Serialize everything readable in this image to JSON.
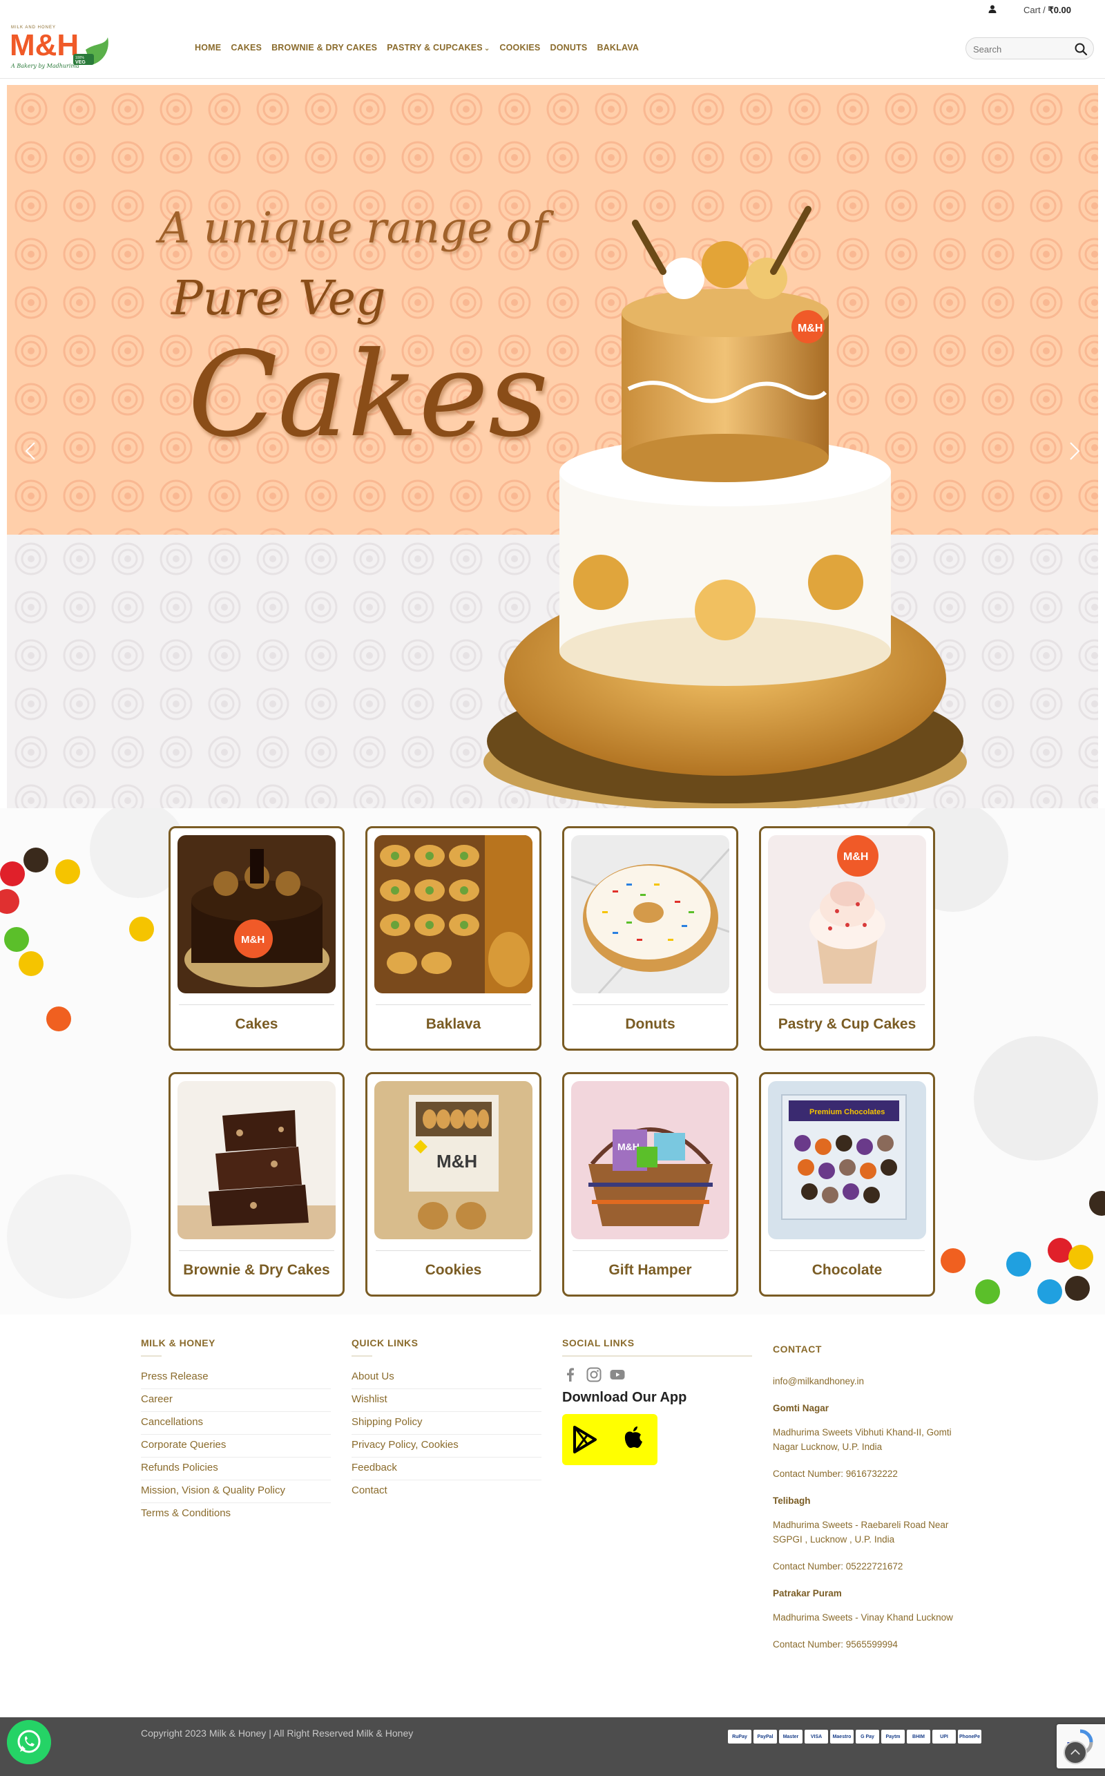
{
  "topbar": {
    "cart_label": "Cart /",
    "cart_amount": "₹0.00"
  },
  "header": {
    "logo_small_text": "MILK AND HONEY",
    "logo_text": "M&H",
    "logo_tagline": "A Bakery by Madhurima",
    "logo_badge": "100% VEG",
    "nav": [
      {
        "label": "HOME"
      },
      {
        "label": "CAKES"
      },
      {
        "label": "BROWNIE & DRY CAKES"
      },
      {
        "label": "PASTRY & CUPCAKES"
      },
      {
        "label": "COOKIES"
      },
      {
        "label": "DONUTS"
      },
      {
        "label": "BAKLAVA"
      }
    ],
    "search_placeholder": "Search"
  },
  "hero": {
    "line1": "A unique range of",
    "line2": "Pure Veg",
    "line3": "Cakes",
    "cake_badge": "M&H",
    "colors": {
      "peach": "#ffcfaa",
      "grey": "#f3f1f2",
      "script": "#8a4d18"
    }
  },
  "categories": [
    {
      "label": "Cakes",
      "icon": "chocolate-cake-image"
    },
    {
      "label": "Baklava",
      "icon": "baklava-image"
    },
    {
      "label": "Donuts",
      "icon": "donut-image"
    },
    {
      "label": "Pastry & Cup Cakes",
      "icon": "cupcake-image",
      "badge": "M&H"
    },
    {
      "label": "Brownie & Dry Cakes",
      "icon": "brownie-image"
    },
    {
      "label": "Cookies",
      "icon": "cookies-box-image",
      "badge": "M&H"
    },
    {
      "label": "Gift Hamper",
      "icon": "gift-hamper-image",
      "badge": "M&H"
    },
    {
      "label": "Chocolate",
      "icon": "chocolate-box-image",
      "badge": "Premium Chocolates"
    }
  ],
  "footer": {
    "col1": {
      "title": "MILK & HONEY",
      "links": [
        "Press Release",
        "Career",
        "Cancellations",
        "Corporate Queries",
        "Refunds Policies",
        "Mission, Vision & Quality Policy",
        "Terms & Conditions"
      ]
    },
    "col2": {
      "title": "QUICK LINKS",
      "links": [
        "About Us",
        "Wishlist",
        "Shipping Policy",
        "Privacy Policy, Cookies",
        "Feedback",
        "Contact"
      ]
    },
    "col3": {
      "title": "SOCIAL LINKS",
      "icons": [
        "facebook-icon",
        "instagram-icon",
        "youtube-icon"
      ],
      "app_title": "Download Our App"
    },
    "col4": {
      "title": "CONTACT",
      "email": "info@milkandhoney.in",
      "branches": [
        {
          "name": "Gomti Nagar",
          "address": "Madhurima Sweets Vibhuti Khand-II, Gomti Nagar Lucknow, U.P. India",
          "phone": "Contact Number: 9616732222"
        },
        {
          "name": "Telibagh",
          "address": "Madhurima Sweets - Raebareli Road Near SGPGI , Lucknow , U.P. India",
          "phone": "Contact Number: 05222721672"
        },
        {
          "name": "Patrakar Puram",
          "address": "Madhurima Sweets - Vinay Khand Lucknow",
          "phone": "Contact Number: 9565599994"
        }
      ]
    }
  },
  "bottom": {
    "copyright": "Copyright 2023 Milk & Honey | All Right Reserved Milk & Honey",
    "payments": [
      "RuPay",
      "PayPal",
      "Master",
      "VISA",
      "Maestro",
      "G Pay",
      "Paytm",
      "BHIM",
      "UPI",
      "PhonePe"
    ]
  }
}
